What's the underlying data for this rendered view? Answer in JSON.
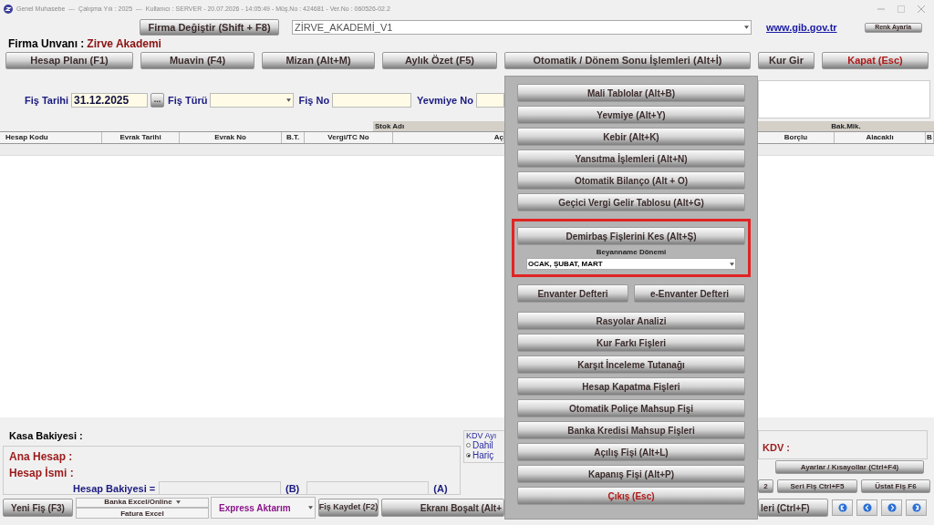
{
  "title_bar": {
    "text": "Genel Muhasebe  ---  Çalışma Yılı : 2025  ---  Kullanıcı : SERVER - 20.07.2026 - 14:05:49 - Müş.No : 424681 - Ver.No : 060526-02.2"
  },
  "header": {
    "firma_button": "Firma Değiştir (Shift + F8)",
    "company_select": "ZİRVE_AKADEMİ_V1",
    "link": "www.gib.gov.tr",
    "color_button": "Renk Ayarla",
    "firma_label": "Firma Unvanı :",
    "firma_name": "Zirve Akademi"
  },
  "toolbar": [
    {
      "label": "Hesap Planı (F1)",
      "kind": "normal"
    },
    {
      "label": "Muavin (F4)",
      "kind": "normal"
    },
    {
      "label": "Mizan (Alt+M)",
      "kind": "normal"
    },
    {
      "label": "Aylık Özet (F5)",
      "kind": "normal"
    },
    {
      "label": "Otomatik / Dönem Sonu İşlemleri (Alt+İ)",
      "kind": "normal"
    },
    {
      "label": "Kur Gir",
      "kind": "normal"
    },
    {
      "label": "Kapat (Esc)",
      "kind": "danger"
    }
  ],
  "voucher_form": {
    "date_label": "Fiş Tarihi",
    "date_value": "31.12.2025",
    "date_button": "...",
    "type_label": "Fiş Türü",
    "number_label": "Fiş No",
    "journal_label": "Yevmiye No"
  },
  "table": {
    "left_group": "Stok Adı",
    "right_group": "Bak.Mik.",
    "columns": [
      "Hesap Kodu",
      "Evrak Tarihi",
      "Evrak No",
      "B.T.",
      "Vergi/TC No",
      "Aç"
    ],
    "right_columns": [
      "Borçlu",
      "Alacaklı",
      "B"
    ]
  },
  "bottom": {
    "cash_label": "Kasa Bakiyesi :",
    "main_account_label": "Ana Hesap :",
    "account_name_label": "Hesap İsmi :",
    "balance_label": "Hesap Bakiyesi =",
    "b_mark": "(B)",
    "a_mark": "(A)",
    "kdv_group": {
      "legend": "KDV Ayı",
      "options": [
        {
          "label": "Dahil",
          "selected": false
        },
        {
          "label": "Hariç",
          "selected": true
        }
      ]
    },
    "kdv_label": "KDV :",
    "settings_button": "Ayarlar / Kısayollar (Ctrl+F4)",
    "small_buttons": [
      "2",
      "Seri Fiş Ctrl+F5",
      "Üstat Fiş F6"
    ],
    "new_button": "Yeni Fiş (F3)",
    "bank_select": "Banka Excel/Online",
    "invoice_button": "Fatura Excel",
    "express_select": "Express Aktarım",
    "save_button": "Fiş Kaydet (F2)",
    "clear_button": "Ekranı Boşalt (Alt+",
    "right_button": "leri (Ctrl+F)"
  },
  "popup": {
    "items": [
      {
        "kind": "button",
        "label": "Mali Tablolar (Alt+B)"
      },
      {
        "kind": "button",
        "label": "Yevmiye (Alt+Y)"
      },
      {
        "kind": "button",
        "label": "Kebir (Alt+K)"
      },
      {
        "kind": "button",
        "label": "Yansıtma İşlemleri (Alt+N)"
      },
      {
        "kind": "button",
        "label": "Otomatik Bilanço (Alt + O)"
      },
      {
        "kind": "button",
        "label": "Geçici Vergi Gelir Tablosu (Alt+G)"
      },
      {
        "kind": "highlight",
        "label": "Demirbaş Fişlerini Kes (Alt+Ş)",
        "field_label": "Beyanname Dönemi",
        "value": "OCAK, ŞUBAT, MART"
      },
      {
        "kind": "pair",
        "labels": [
          "Envanter Defteri",
          "e-Envanter Defteri"
        ]
      },
      {
        "kind": "button",
        "label": "Rasyolar Analizi"
      },
      {
        "kind": "button",
        "label": "Kur Farkı Fişleri"
      },
      {
        "kind": "button",
        "label": "Karşıt İnceleme Tutanağı"
      },
      {
        "kind": "button",
        "label": "Hesap Kapatma Fişleri"
      },
      {
        "kind": "button",
        "label": "Otomatik Poliçe Mahsup Fişi"
      },
      {
        "kind": "button",
        "label": "Banka Kredisi Mahsup Fişleri"
      },
      {
        "kind": "button",
        "label": "Açılış Fişi (Alt+L)"
      },
      {
        "kind": "button",
        "label": "Kapanış Fişi (Alt+P)"
      },
      {
        "kind": "exit",
        "label": "Çıkış (Esc)"
      }
    ]
  }
}
